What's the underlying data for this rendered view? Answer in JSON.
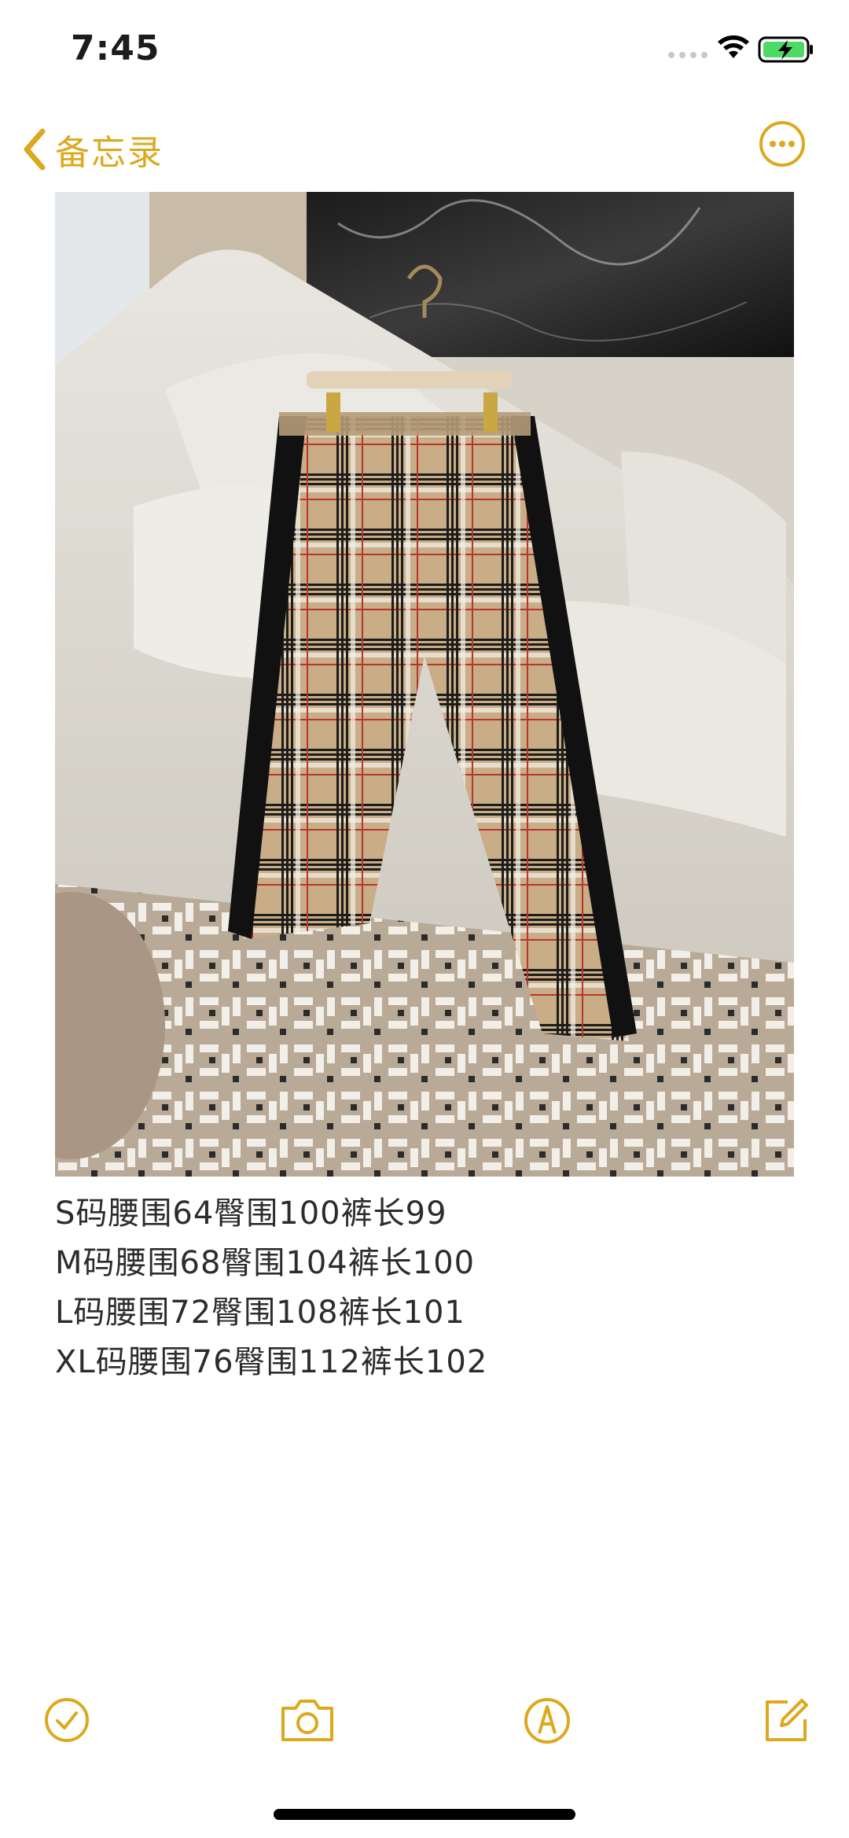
{
  "status_bar": {
    "time": "7:45",
    "icons": [
      "cellular-signal-icon",
      "wifi-icon",
      "battery-charging-icon"
    ],
    "battery_color": "#4cd964"
  },
  "nav": {
    "back_label": "备忘录",
    "back_icon": "chevron-left-icon",
    "more_icon": "ellipsis-circle-icon",
    "accent_color": "#dca91e"
  },
  "photo": {
    "description_icon": "product-photo"
  },
  "note": {
    "lines": [
      "S码腰围64臀围100裤长99",
      "M码腰围68臀围104裤长100",
      "L码腰围72臀围108裤长101",
      "XL码腰围76臀围112裤长102"
    ]
  },
  "toolbar": {
    "items": [
      "checklist-icon",
      "camera-icon",
      "markup-icon",
      "compose-icon"
    ]
  }
}
